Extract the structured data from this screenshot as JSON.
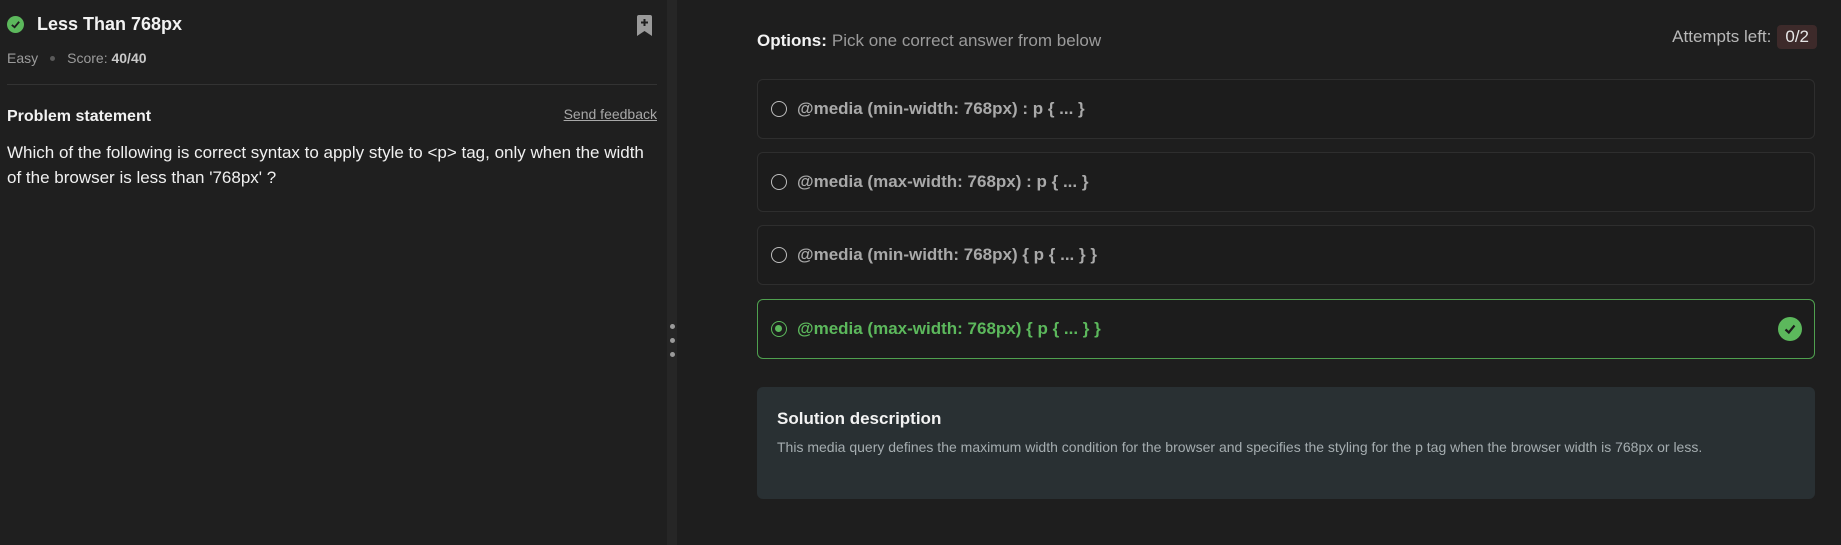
{
  "problem": {
    "title": "Less Than 768px",
    "difficulty": "Easy",
    "score_label": "Score:",
    "score_value": "40/40",
    "statement_heading": "Problem statement",
    "feedback_link": "Send feedback",
    "question": "Which of the following is correct syntax to apply style to <p> tag, only when the width of the browser is less than '768px' ?"
  },
  "options_panel": {
    "label_bold": "Options:",
    "label_rest": "Pick one correct answer from below",
    "attempts_label": "Attempts left:",
    "attempts_value": "0/2",
    "options": [
      {
        "text": "@media (min-width: 768px) : p { ... }",
        "selected": false
      },
      {
        "text": "@media (max-width: 768px) : p { ... }",
        "selected": false
      },
      {
        "text": "@media (min-width: 768px) { p { ... } }",
        "selected": false
      },
      {
        "text": "@media (max-width: 768px) { p { ... } }",
        "selected": true
      }
    ]
  },
  "solution": {
    "title": "Solution description",
    "text": "This media query defines the maximum width condition for the browser and specifies the styling for the p tag when the browser width is 768px or less."
  },
  "colors": {
    "accent_green": "#5cb85c",
    "background": "#1e1e1e",
    "solution_bg": "#293033"
  },
  "icons": [
    "check-circle-icon",
    "bookmark-add-icon",
    "drag-handle-icon",
    "radio-icon"
  ]
}
